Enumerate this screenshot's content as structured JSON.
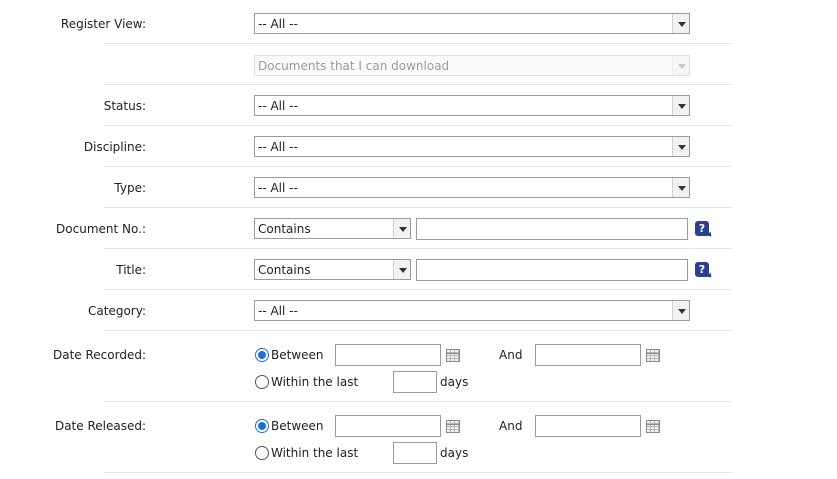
{
  "register_view": {
    "label": "Register View:",
    "value": "-- All --"
  },
  "download_filter": {
    "value": "Documents that I can download"
  },
  "status": {
    "label": "Status:",
    "value": "-- All --"
  },
  "discipline": {
    "label": "Discipline:",
    "value": "-- All --"
  },
  "type": {
    "label": "Type:",
    "value": "-- All --"
  },
  "document_no": {
    "label": "Document No.:",
    "operator": "Contains",
    "value": "",
    "help": "?"
  },
  "title": {
    "label": "Title:",
    "operator": "Contains",
    "value": "",
    "help": "?"
  },
  "category": {
    "label": "Category:",
    "value": "-- All --"
  },
  "date_recorded": {
    "label": "Date Recorded:",
    "between_label": "Between",
    "and_label": "And",
    "within_label": "Within the last",
    "days_label": "days",
    "from": "",
    "to": "",
    "days": "",
    "selected": "between"
  },
  "date_released": {
    "label": "Date Released:",
    "between_label": "Between",
    "and_label": "And",
    "within_label": "Within the last",
    "days_label": "days",
    "from": "",
    "to": "",
    "days": "",
    "selected": "between"
  }
}
